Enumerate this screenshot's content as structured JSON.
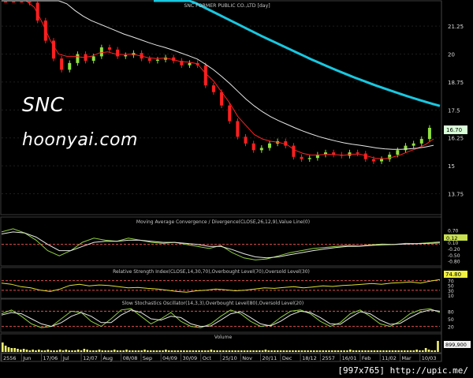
{
  "overlay_text": {
    "ticker": "SNC",
    "site": "hoonyai.com"
  },
  "credit": "[997x765] http://upic.me/",
  "chart_data": [
    {
      "type": "line",
      "panel": "price",
      "title": "SNC FORMER PUBLIC CO.,LTD [day]",
      "y_ticks": [
        "21.25",
        "20",
        "18.75",
        "17.5",
        "16.25",
        "15",
        "13.75"
      ],
      "y_tick_values": [
        21.25,
        20,
        18.75,
        17.5,
        16.25,
        15,
        13.75
      ],
      "ylim": [
        12.85,
        22.35
      ],
      "last_label": "16.70",
      "last_value": 16.7,
      "x_labels": [
        "2556",
        "Jun",
        "17/06",
        "Jul",
        "12/07",
        "Aug",
        "08/08",
        "Sep",
        "04/09",
        "30/09",
        "Oct",
        "25/10",
        "Nov",
        "20/11",
        "Dec",
        "18/12",
        "2557",
        "16/01",
        "Feb",
        "11/02",
        "Mar",
        "10/03"
      ],
      "series": [
        {
          "kind": "price",
          "values": [
            23.2,
            22.8,
            22.6,
            22.3,
            21.5,
            20.6,
            19.8,
            19.3,
            19.6,
            20.0,
            19.7,
            19.9,
            20.3,
            20.2,
            19.9,
            19.95,
            20.05,
            19.8,
            19.7,
            19.75,
            19.85,
            19.7,
            19.5,
            19.6,
            19.5,
            18.6,
            18.3,
            17.7,
            17.0,
            16.3,
            16.0,
            15.7,
            15.8,
            16.0,
            16.1,
            15.9,
            15.4,
            15.3,
            15.35,
            15.5,
            15.6,
            15.5,
            15.45,
            15.6,
            15.55,
            15.3,
            15.2,
            15.3,
            15.5,
            15.7,
            15.9,
            16.0,
            16.2,
            16.7
          ]
        },
        {
          "kind": "ema-short",
          "color": "#ff2020",
          "values": [
            23.5,
            23.1,
            22.8,
            22.6,
            22.1,
            21.4,
            20.6,
            20.0,
            19.9,
            19.9,
            19.85,
            19.9,
            20.05,
            20.1,
            20.0,
            19.98,
            20.0,
            19.92,
            19.84,
            19.8,
            19.82,
            19.76,
            19.66,
            19.64,
            19.57,
            19.15,
            18.8,
            18.3,
            17.8,
            17.2,
            16.8,
            16.4,
            16.2,
            16.1,
            16.05,
            15.95,
            15.7,
            15.55,
            15.48,
            15.49,
            15.52,
            15.5,
            15.47,
            15.52,
            15.52,
            15.42,
            15.33,
            15.32,
            15.39,
            15.5,
            15.65,
            15.78,
            15.95,
            16.2
          ]
        },
        {
          "kind": "ema-long",
          "color": "#e8e8e8",
          "values": [
            25.0,
            24.7,
            24.4,
            24.1,
            23.8,
            23.4,
            23.0,
            22.6,
            22.25,
            21.95,
            21.7,
            21.5,
            21.35,
            21.2,
            21.05,
            20.9,
            20.78,
            20.65,
            20.52,
            20.4,
            20.3,
            20.18,
            20.05,
            19.92,
            19.78,
            19.55,
            19.3,
            19.0,
            18.68,
            18.33,
            17.98,
            17.68,
            17.42,
            17.2,
            17.02,
            16.86,
            16.7,
            16.55,
            16.42,
            16.3,
            16.2,
            16.11,
            16.03,
            15.97,
            15.92,
            15.86,
            15.8,
            15.76,
            15.74,
            15.74,
            15.76,
            15.79,
            15.84,
            15.92
          ]
        },
        {
          "kind": "ema-200",
          "color": "#18c8e0",
          "values": [
            23.2,
            23.05,
            22.9,
            22.74,
            22.58,
            22.42,
            22.26,
            22.1,
            21.94,
            21.78,
            21.62,
            21.46,
            21.3,
            21.14,
            20.98,
            20.82,
            20.67,
            20.52,
            20.37,
            20.22,
            20.07,
            19.92,
            19.77,
            19.63,
            19.49,
            19.35,
            19.22,
            19.09,
            18.96,
            18.84,
            18.72,
            18.6,
            18.49,
            18.38,
            18.27,
            18.16,
            18.06,
            17.96,
            17.86,
            17.77,
            17.68
          ]
        }
      ]
    },
    {
      "type": "line",
      "panel": "macd",
      "title": "Moving Average Convergence / Divergence(CLOSE,26,12,9),Value Line(0)",
      "y_ticks": [
        "0.70",
        "0.40",
        "0.10",
        "-0.20",
        "-0.50",
        "-0.80"
      ],
      "y_tick_values": [
        0.7,
        0.4,
        0.1,
        -0.2,
        -0.5,
        -0.8
      ],
      "ylim": [
        -1.0,
        0.9
      ],
      "last_label": "0.12",
      "series": [
        {
          "kind": "macd",
          "color": "#90d040",
          "values": [
            0.6,
            0.75,
            0.55,
            0.2,
            -0.3,
            -0.55,
            -0.3,
            0.1,
            0.3,
            0.2,
            0.15,
            0.3,
            0.2,
            0.1,
            0.05,
            0.1,
            0.0,
            -0.1,
            -0.2,
            -0.05,
            -0.4,
            -0.65,
            -0.75,
            -0.7,
            -0.55,
            -0.4,
            -0.3,
            -0.2,
            -0.15,
            -0.1,
            -0.05,
            -0.08,
            -0.02,
            0.02,
            0.0,
            0.05,
            0.04,
            0.08,
            0.12
          ]
        },
        {
          "kind": "signal",
          "color": "#e8e8e8",
          "values": [
            0.5,
            0.6,
            0.55,
            0.35,
            0.0,
            -0.3,
            -0.3,
            -0.1,
            0.1,
            0.15,
            0.15,
            0.2,
            0.2,
            0.15,
            0.1,
            0.1,
            0.05,
            0.0,
            -0.1,
            -0.1,
            -0.25,
            -0.45,
            -0.6,
            -0.65,
            -0.6,
            -0.5,
            -0.4,
            -0.3,
            -0.22,
            -0.15,
            -0.1,
            -0.09,
            -0.05,
            -0.02,
            -0.01,
            0.02,
            0.03,
            0.05,
            0.07
          ]
        }
      ]
    },
    {
      "type": "line",
      "panel": "rsi",
      "title": "Relative Strength Index(CLOSE,14,30,70),Overbought Level(70),Oversold Level(30)",
      "y_ticks": [
        "70",
        "50",
        "30",
        "10"
      ],
      "y_tick_values": [
        70,
        50,
        30,
        10
      ],
      "ylim": [
        0,
        95
      ],
      "levels": [
        70,
        30
      ],
      "last_label": "74.80",
      "series": [
        {
          "kind": "rsi",
          "color": "#e0e030",
          "values": [
            60,
            55,
            45,
            40,
            30,
            25,
            35,
            50,
            55,
            48,
            52,
            50,
            45,
            40,
            42,
            38,
            35,
            30,
            25,
            22,
            28,
            30,
            35,
            32,
            28,
            30,
            35,
            40,
            38,
            42,
            45,
            40,
            44,
            48,
            46,
            50,
            52,
            55,
            58,
            55,
            60,
            62,
            65,
            60,
            68,
            74.8
          ]
        }
      ]
    },
    {
      "type": "line",
      "panel": "stochastic",
      "title": "Slow Stochastics Oscillator(14,3,3),Overbought Level(80),Oversold Level(20)",
      "y_ticks": [
        "80",
        "50",
        "20"
      ],
      "y_tick_values": [
        80,
        50,
        20
      ],
      "ylim": [
        0,
        100
      ],
      "levels": [
        80,
        20
      ],
      "series": [
        {
          "kind": "k",
          "color": "#90d040",
          "values": [
            70,
            85,
            60,
            30,
            15,
            20,
            50,
            80,
            75,
            40,
            20,
            50,
            85,
            90,
            60,
            30,
            50,
            75,
            40,
            20,
            15,
            30,
            60,
            85,
            70,
            40,
            20,
            25,
            55,
            80,
            85,
            70,
            40,
            20,
            35,
            70,
            85,
            60,
            30,
            20,
            40,
            70,
            85,
            90,
            75
          ]
        },
        {
          "kind": "d",
          "color": "#e8e8e8",
          "values": [
            65,
            75,
            70,
            50,
            30,
            20,
            35,
            60,
            75,
            60,
            35,
            35,
            65,
            85,
            75,
            50,
            45,
            60,
            55,
            30,
            20,
            22,
            45,
            70,
            78,
            55,
            30,
            22,
            40,
            65,
            80,
            75,
            55,
            30,
            28,
            55,
            78,
            70,
            45,
            28,
            32,
            55,
            75,
            85,
            80
          ]
        }
      ]
    },
    {
      "type": "bar",
      "panel": "volume",
      "title": "Volume",
      "last_label": "899,900",
      "values": [
        12,
        8,
        6,
        5,
        5,
        4,
        3,
        4,
        3,
        2,
        3,
        2,
        3,
        2,
        2,
        3,
        2,
        2,
        2,
        3,
        2,
        3,
        2,
        2,
        2,
        3,
        2,
        4,
        3,
        2,
        2,
        2,
        3,
        2,
        2,
        2,
        2,
        3,
        2,
        2,
        2,
        3,
        2,
        2,
        2,
        2,
        2,
        3,
        2,
        2,
        2,
        2,
        2,
        2,
        3,
        2,
        2,
        2,
        2,
        2,
        2,
        2,
        2,
        2,
        2,
        2,
        2,
        2,
        2,
        3,
        2,
        2,
        2,
        2,
        2,
        2,
        2,
        2,
        2,
        2,
        2,
        2,
        2,
        2,
        2,
        2,
        2,
        3,
        2,
        2,
        2,
        2,
        2,
        2,
        2,
        2,
        2,
        2,
        2,
        2,
        2,
        2,
        2,
        2,
        2,
        2,
        2,
        2,
        2,
        2,
        2,
        2,
        2,
        2,
        2,
        3,
        2,
        2,
        2,
        2,
        2,
        2,
        2,
        2,
        2,
        2,
        2,
        2,
        2,
        2,
        2,
        2,
        2,
        2,
        2,
        2,
        2,
        3,
        2,
        2,
        5,
        3,
        2,
        2,
        14
      ]
    }
  ]
}
